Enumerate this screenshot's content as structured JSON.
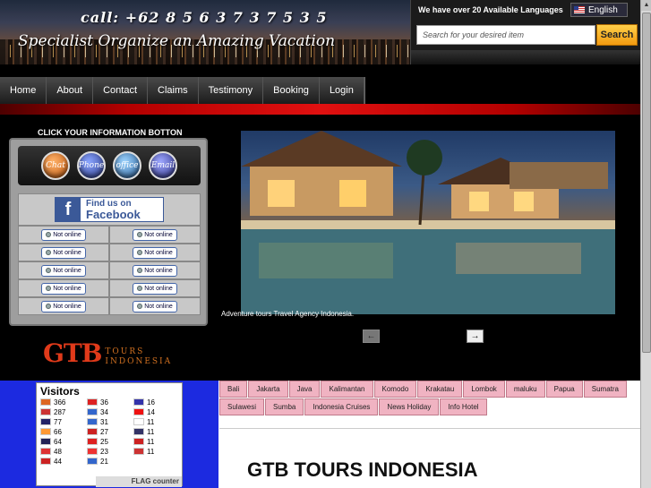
{
  "header": {
    "phone": "call: +62 8 5 6 3 7 3 7 5 3 5",
    "tagline": "Specialist Organize an Amazing Vacation"
  },
  "language": {
    "notice": "We have over 20 Available Languages",
    "selected": "English"
  },
  "search": {
    "placeholder": "Search for your desired item",
    "button_label": "Search"
  },
  "nav": {
    "items": [
      "Home",
      "About",
      "Contact",
      "Claims",
      "Testimony",
      "Booking",
      "Login"
    ]
  },
  "info_panel": {
    "title": "CLICK YOUR INFORMATION BOTTON",
    "bubbles": [
      "Chat",
      "Phone",
      "office",
      "Email"
    ],
    "facebook_line1": "Find us on",
    "facebook_line2": "Facebook",
    "status_text": "Not online"
  },
  "logo": {
    "big": "GTB",
    "small_top": "TOURS",
    "small_bottom": "INDONESIA"
  },
  "slideshow": {
    "caption": "Adventure tours Travel Agency Indonesia."
  },
  "visitors": {
    "title": "Visitors",
    "rows": [
      [
        {
          "count": "366",
          "color": "#d62"
        },
        {
          "count": "36",
          "color": "#d22"
        },
        {
          "count": "16",
          "color": "#33a"
        }
      ],
      [
        {
          "count": "287",
          "color": "#c33"
        },
        {
          "count": "34",
          "color": "#36c"
        },
        {
          "count": "14",
          "color": "#e11"
        }
      ],
      [
        {
          "count": "77",
          "color": "#226"
        },
        {
          "count": "31",
          "color": "#36c"
        },
        {
          "count": "11",
          "color": "#fff"
        }
      ],
      [
        {
          "count": "66",
          "color": "#f93"
        },
        {
          "count": "27",
          "color": "#c22"
        },
        {
          "count": "11",
          "color": "#336"
        }
      ],
      [
        {
          "count": "64",
          "color": "#225"
        },
        {
          "count": "25",
          "color": "#d22"
        },
        {
          "count": "11",
          "color": "#c22"
        }
      ],
      [
        {
          "count": "48",
          "color": "#d33"
        },
        {
          "count": "23",
          "color": "#e33"
        },
        {
          "count": "11",
          "color": "#c33"
        }
      ],
      [
        {
          "count": "44",
          "color": "#c22"
        },
        {
          "count": "21",
          "color": "#36c"
        }
      ]
    ],
    "counter_label": "FLAG counter"
  },
  "tabs": {
    "row1": [
      "Bali",
      "Jakarta",
      "Java",
      "Kalimantan",
      "Komodo",
      "Krakatau",
      "Lombok",
      "maluku",
      "Papua",
      "Sumatra"
    ],
    "row2": [
      "Sulawesi",
      "Sumba",
      "Indonesia Cruises",
      "News Holiday",
      "Info Hotel"
    ]
  },
  "main": {
    "headline": "GTB TOURS INDONESIA"
  },
  "colors": {
    "accent_red": "#e01010",
    "search_orange": "#f29a10",
    "tab_pink": "#f0b3c2",
    "visitor_blue": "#1c2ae0"
  }
}
